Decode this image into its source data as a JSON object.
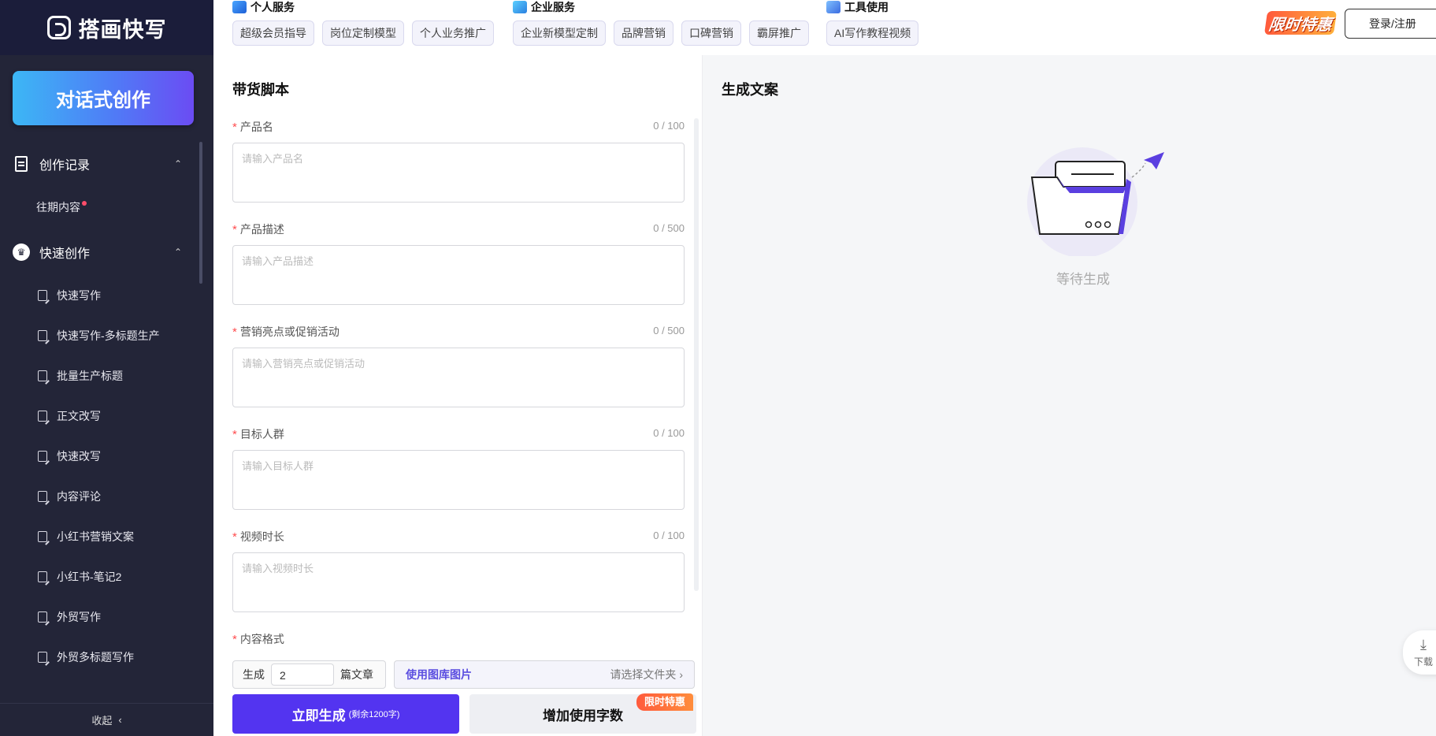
{
  "sidebar": {
    "logo_text": "搭画快写",
    "cta_label": "对话式创作",
    "groups": [
      {
        "label": "创作记录",
        "items": [
          "往期内容"
        ]
      },
      {
        "label": "快速创作",
        "items": [
          "快速写作",
          "快速写作-多标题生产",
          "批量生产标题",
          "正文改写",
          "快速改写",
          "内容评论",
          "小红书营销文案",
          "小红书-笔记2",
          "外贸写作",
          "外贸多标题写作"
        ]
      }
    ],
    "collapse_label": "收起"
  },
  "topbar": {
    "services": [
      {
        "title": "个人服务",
        "chips": [
          "超级会员指导",
          "岗位定制模型",
          "个人业务推广"
        ]
      },
      {
        "title": "企业服务",
        "chips": [
          "企业新模型定制",
          "品牌营销",
          "口碑营销",
          "霸屏推广"
        ]
      },
      {
        "title": "工具使用",
        "chips": [
          "AI写作教程视频"
        ]
      }
    ],
    "promo_label": "限时特惠",
    "login_label": "登录/注册"
  },
  "form": {
    "title": "带货脚本",
    "fields": [
      {
        "label": "产品名",
        "count": "0 / 100",
        "placeholder": "请输入产品名"
      },
      {
        "label": "产品描述",
        "count": "0 / 500",
        "placeholder": "请输入产品描述"
      },
      {
        "label": "营销亮点或促销活动",
        "count": "0 / 500",
        "placeholder": "请输入营销亮点或促销活动"
      },
      {
        "label": "目标人群",
        "count": "0 / 100",
        "placeholder": "请输入目标人群"
      },
      {
        "label": "视频时长",
        "count": "0 / 100",
        "placeholder": "请输入视频时长"
      }
    ],
    "format_label": "内容格式",
    "gen_prefix": "生成",
    "gen_count": "2",
    "gen_suffix": "篇文章",
    "library_label": "使用图库图片",
    "folder_label": "请选择文件夹",
    "generate_label": "立即生成",
    "generate_note": "(剩余1200字)",
    "add_words_label": "增加使用字数",
    "add_words_badge": "限时特惠"
  },
  "output": {
    "title": "生成文案",
    "empty_text": "等待生成"
  },
  "download_label": "下载",
  "colors": {
    "primary": "#5334f0",
    "sidebar": "#232538",
    "required": "#ff4d4f"
  }
}
